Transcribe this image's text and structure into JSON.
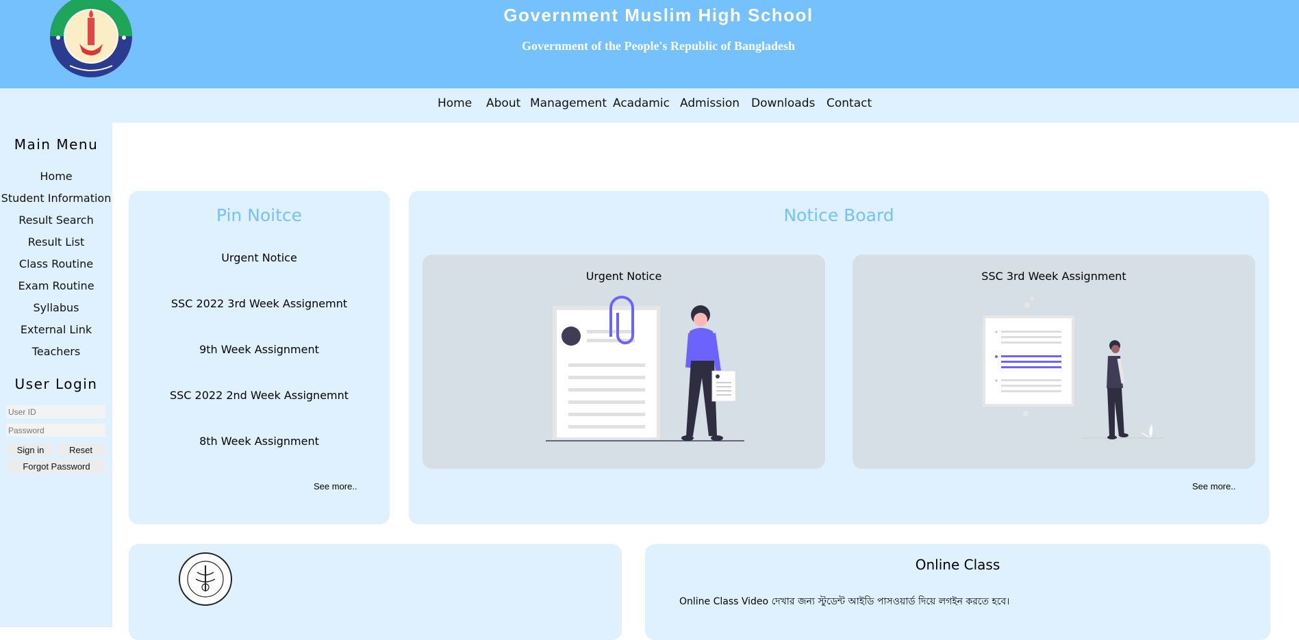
{
  "header": {
    "title": "Government Muslim High School",
    "subtitle": "Government of the People's Republic of Bangladesh",
    "colors": {
      "header_bg": "#74c1fd",
      "nav_bg": "#dff1fe",
      "panel_bg": "#dff1fe",
      "accent_title": "#74c1fd"
    }
  },
  "nav": {
    "items": [
      "Home",
      "About",
      "Management",
      "Acadamic",
      "Admission",
      "Downloads",
      "Contact"
    ]
  },
  "sidebar": {
    "main_menu_title": "Main Menu",
    "items": [
      "Home",
      "Student Information",
      "Result Search",
      "Result List",
      "Class Routine",
      "Exam Routine",
      "Syllabus",
      "External Link",
      "Teachers"
    ],
    "login": {
      "title": "User Login",
      "user_placeholder": "User ID",
      "password_placeholder": "Password",
      "sign_in": "Sign in",
      "reset": "Reset",
      "forgot": "Forgot Password"
    }
  },
  "pin_notice": {
    "title": "Pin Noitce",
    "items": [
      "Urgent Notice",
      "SSC 2022 3rd Week Assignemnt",
      "9th Week Assignment",
      "SSC 2022 2nd Week Assignemnt",
      "8th Week Assignment"
    ],
    "see_more": "See more.."
  },
  "notice_board": {
    "title": "Notice Board",
    "cards": [
      {
        "title": "Urgent Notice",
        "illustration": "document-woman-illustration"
      },
      {
        "title": "SSC 3rd Week Assignment",
        "illustration": "document-man-illustration"
      }
    ],
    "see_more": "See more.."
  },
  "online_class": {
    "title": "Online Class",
    "text": "Online Class Video দেখার জন্য স্টুডেন্ট আইডি পাসওয়ার্ড দিয়ে লগইন করতে হবে।"
  }
}
